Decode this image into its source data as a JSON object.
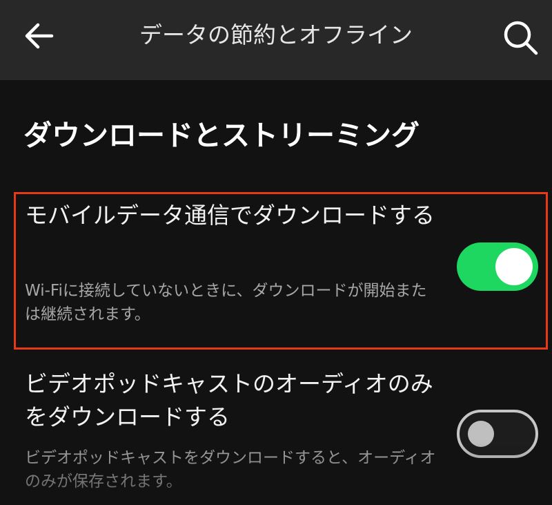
{
  "header": {
    "back_icon": "arrow-left-icon",
    "title": "データの節約とオフライン",
    "search_icon": "search-icon"
  },
  "section": {
    "heading": "ダウンロードとストリーミング"
  },
  "settings": [
    {
      "title": "モバイルデータ通信でダウンロードする",
      "description": "Wi-Fiに接続していないときに、ダウンロードが開始または継続されます。",
      "enabled": true
    },
    {
      "title": "ビデオポッドキャストのオーディオのみをダウンロードする",
      "description": "ビデオポッドキャストをダウンロードすると、オーディオのみが保存されます。",
      "enabled": false
    }
  ],
  "colors": {
    "background": "#121212",
    "appbar": "#282828",
    "accent": "#1ed760",
    "highlight": "#e63a17",
    "secondary_text": "#a7a7a7"
  }
}
